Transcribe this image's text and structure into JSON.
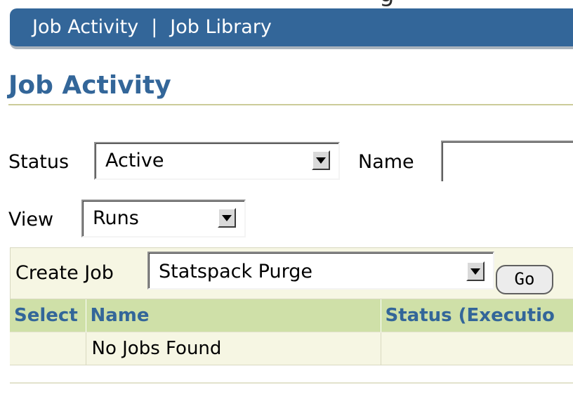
{
  "tabs": [
    {
      "label": "Job Activity"
    },
    {
      "label": "Job Library"
    }
  ],
  "tab_separator": "|",
  "page_title": "Job Activity",
  "filters": {
    "status_label": "Status",
    "status_value": "Active",
    "name_label": "Name",
    "name_value": "",
    "view_label": "View",
    "view_value": "Runs"
  },
  "create_job": {
    "label": "Create Job",
    "value": "Statspack Purge",
    "go_label": "Go"
  },
  "table": {
    "columns": [
      "Select",
      "Name",
      "Status (Executio"
    ],
    "empty_message": "No Jobs Found"
  },
  "colors": {
    "brand": "#336699",
    "header_bg": "#cfe0a8",
    "row_bg": "#f6f6e3"
  }
}
